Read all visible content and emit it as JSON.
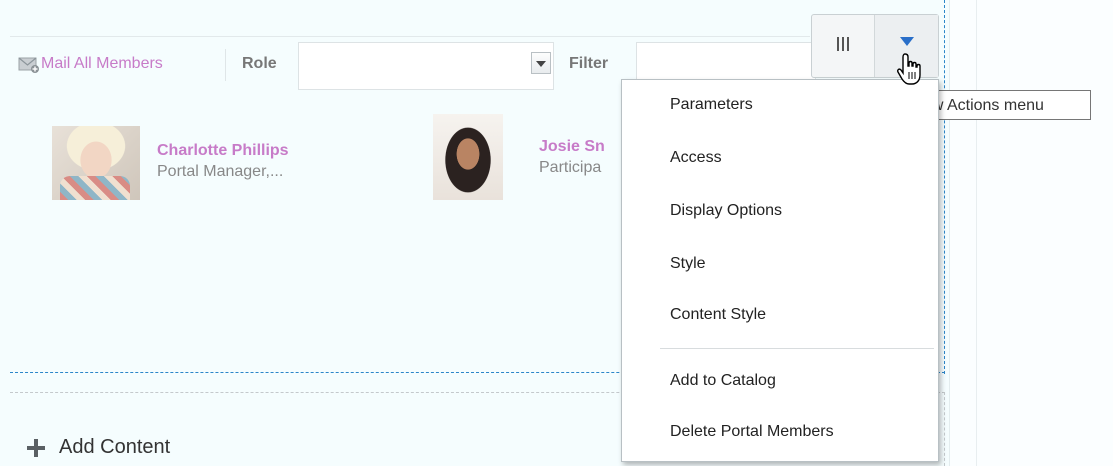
{
  "toolbar": {
    "mail_all_label": "Mail All Members",
    "role_label": "Role",
    "role_value": "",
    "filter_label": "Filter",
    "filter_value": ""
  },
  "members": [
    {
      "name": "Charlotte Phillips",
      "role": "Portal Manager,..."
    },
    {
      "name": "Josie Sn",
      "role": "Participa"
    }
  ],
  "add_content_label": "Add Content",
  "actions_menu": {
    "tooltip": "View Actions menu",
    "items": [
      "Parameters",
      "Access",
      "Display Options",
      "Style",
      "Content Style",
      "Add to Catalog",
      "Delete Portal Members"
    ]
  },
  "icons": {
    "mail": "mail-all-icon",
    "columns": "columns-icon",
    "actions": "dropdown-triangle-icon",
    "add": "plus-icon",
    "cursor": "hand-pointer-icon"
  },
  "colors": {
    "link": "#c77bc8",
    "accent": "#2a6fc9",
    "background": "#f5fdfe"
  }
}
